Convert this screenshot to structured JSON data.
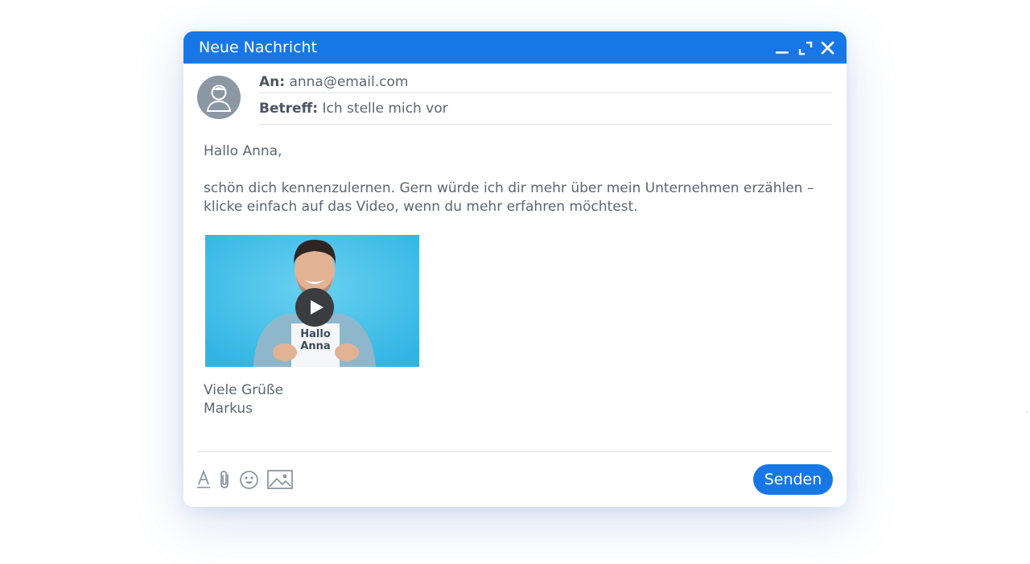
{
  "window": {
    "title": "Neue Nachricht"
  },
  "compose": {
    "to_label": "An:",
    "to_value": "anna@email.com",
    "subject_label": "Betreff:",
    "subject_value": "Ich stelle mich vor"
  },
  "message": {
    "greeting": "Hallo Anna,",
    "line1": "schön dich kennenzulernen. Gern würde ich dir mehr über mein Unternehmen erzählen –",
    "line2": "klicke einfach auf das Video, wenn du mehr erfahren möchtest.",
    "video_sign_line1": "Hallo",
    "video_sign_line2": "Anna",
    "closing": "Viele Grüße",
    "signature": "Markus"
  },
  "toolbar": {
    "send_label": "Senden"
  },
  "icons": [
    "minimize-icon",
    "expand-icon",
    "close-icon",
    "avatar-user-icon",
    "text-format-icon",
    "paperclip-icon",
    "emoji-icon",
    "image-icon",
    "play-icon"
  ],
  "colors": {
    "accent": "#1877e7",
    "text": "#5d6672",
    "video_bg": "#4cc3ea"
  }
}
